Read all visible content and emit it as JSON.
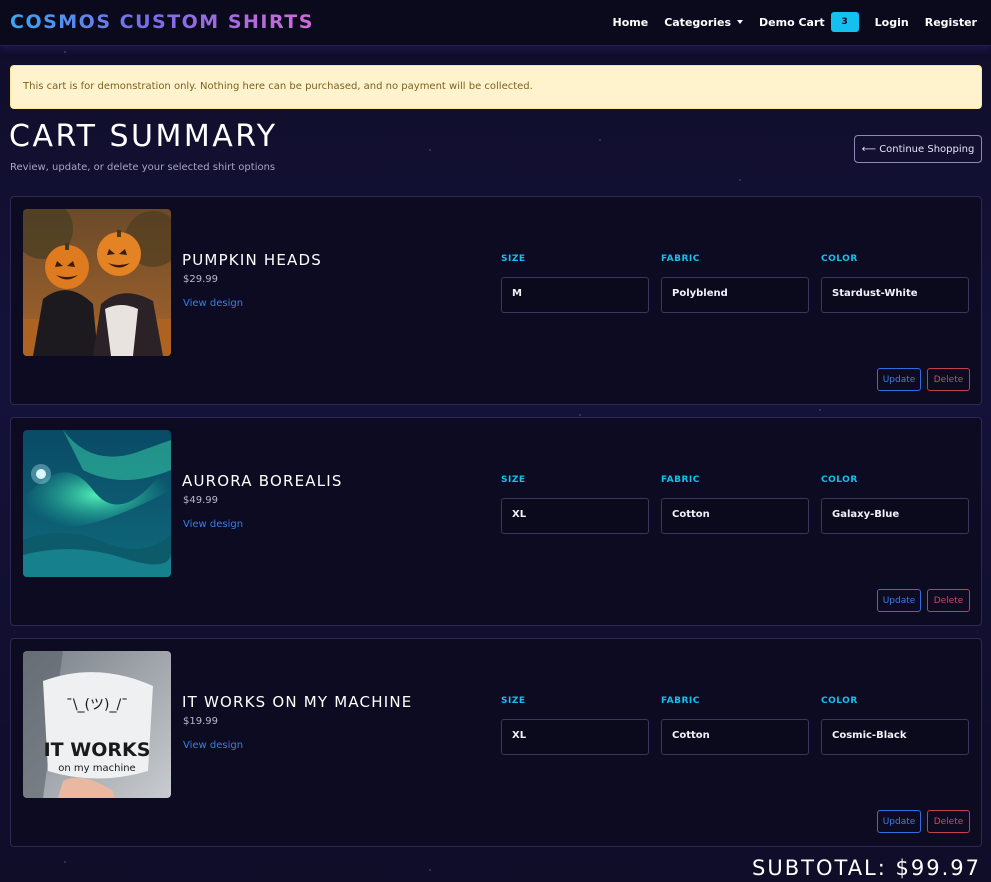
{
  "nav": {
    "brand": "COSMOS CUSTOM SHIRTS",
    "home": "Home",
    "categories": "Categories",
    "cart": "Demo Cart",
    "cart_count": "3",
    "login": "Login",
    "register": "Register"
  },
  "alert": "This cart is for demonstration only. Nothing here can be purchased, and no payment will be collected.",
  "header": {
    "title": "CART SUMMARY",
    "subtitle": "Review, update, or delete your selected shirt options",
    "continue": "⟵ Continue Shopping"
  },
  "labels": {
    "size": "SIZE",
    "fabric": "FABRIC",
    "color": "COLOR",
    "view": "View design",
    "update": "Update",
    "delete": "Delete"
  },
  "items": [
    {
      "name": "PUMPKIN HEADS",
      "price": "$29.99",
      "size": "M",
      "fabric": "Polyblend",
      "color": "Stardust-White"
    },
    {
      "name": "AURORA BOREALIS",
      "price": "$49.99",
      "size": "XL",
      "fabric": "Cotton",
      "color": "Galaxy-Blue"
    },
    {
      "name": "IT WORKS ON MY MACHINE",
      "price": "$19.99",
      "size": "XL",
      "fabric": "Cotton",
      "color": "Cosmic-Black"
    }
  ],
  "image_text": {
    "shrug": "¯\\_(ツ)_/¯",
    "line1": "IT WORKS",
    "line2": "on my machine"
  },
  "subtotal": "SUBTOTAL: $99.97"
}
